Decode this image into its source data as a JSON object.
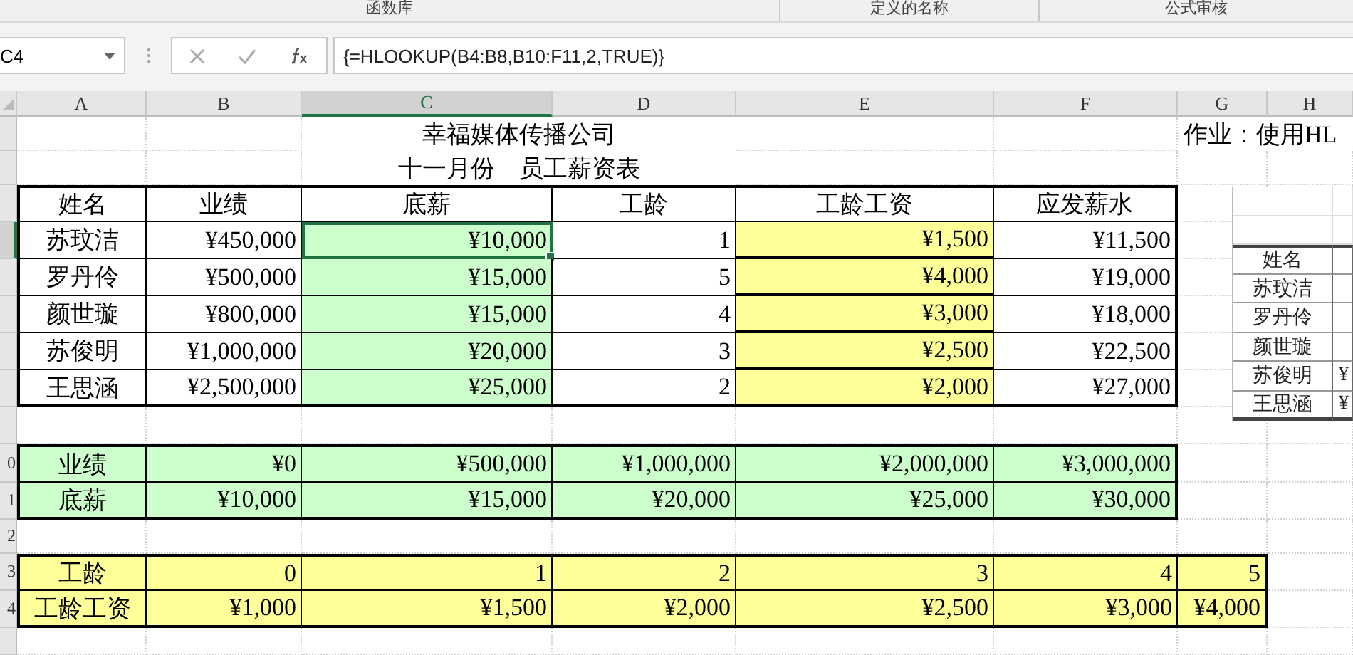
{
  "ribbon_groups": [
    "函数库",
    "定义的名称",
    "公式审核"
  ],
  "formula_bar": {
    "name_box": "C4",
    "formula": "{=HLOOKUP(B4:B8,B10:F11,2,TRUE)}"
  },
  "columns": [
    {
      "label": "A",
      "selected": false
    },
    {
      "label": "B",
      "selected": false
    },
    {
      "label": "C",
      "selected": true
    },
    {
      "label": "D",
      "selected": false
    },
    {
      "label": "E",
      "selected": false
    },
    {
      "label": "F",
      "selected": false
    },
    {
      "label": "G",
      "selected": false
    },
    {
      "label": "H",
      "selected": false
    }
  ],
  "row_headers": [
    {
      "row_label": "0"
    },
    {
      "row_label": "1"
    },
    {
      "row_label": "2"
    },
    {
      "row_label": "3"
    },
    {
      "row_label": "4"
    }
  ],
  "title": "幸福媒体传播公司",
  "subtitle": "十一月份　员工薪资表",
  "note": "作业：使用HL",
  "salary_table": {
    "columns": [
      "姓名",
      "业绩",
      "底薪",
      "工龄",
      "工龄工资",
      "应发薪水"
    ],
    "rows": [
      {
        "cells": [
          {
            "text": "苏玟洁",
            "selected": false
          },
          {
            "text": "¥450,000",
            "selected": false
          },
          {
            "text": "¥10,000",
            "selected": true
          },
          {
            "text": "1",
            "selected": false
          },
          {
            "text": "¥1,500",
            "selected": false
          },
          {
            "text": "¥11,500",
            "selected": false
          }
        ]
      },
      {
        "cells": [
          {
            "text": "罗丹伶",
            "selected": false
          },
          {
            "text": "¥500,000",
            "selected": false
          },
          {
            "text": "¥15,000",
            "selected": false
          },
          {
            "text": "5",
            "selected": false
          },
          {
            "text": "¥4,000",
            "selected": false
          },
          {
            "text": "¥19,000",
            "selected": false
          }
        ]
      },
      {
        "cells": [
          {
            "text": "颜世璇",
            "selected": false
          },
          {
            "text": "¥800,000",
            "selected": false
          },
          {
            "text": "¥15,000",
            "selected": false
          },
          {
            "text": "4",
            "selected": false
          },
          {
            "text": "¥3,000",
            "selected": false
          },
          {
            "text": "¥18,000",
            "selected": false
          }
        ]
      },
      {
        "cells": [
          {
            "text": "苏俊明",
            "selected": false
          },
          {
            "text": "¥1,000,000",
            "selected": false
          },
          {
            "text": "¥20,000",
            "selected": false
          },
          {
            "text": "3",
            "selected": false
          },
          {
            "text": "¥2,500",
            "selected": false
          },
          {
            "text": "¥22,500",
            "selected": false
          }
        ]
      },
      {
        "cells": [
          {
            "text": "王思涵",
            "selected": false
          },
          {
            "text": "¥2,500,000",
            "selected": false
          },
          {
            "text": "¥25,000",
            "selected": false
          },
          {
            "text": "2",
            "selected": false
          },
          {
            "text": "¥2,000",
            "selected": false
          },
          {
            "text": "¥27,000",
            "selected": false
          }
        ]
      }
    ]
  },
  "base_lookup": [
    {
      "label": "业绩",
      "values": [
        "¥0",
        "¥500,000",
        "¥1,000,000",
        "¥2,000,000",
        "¥3,000,000"
      ]
    },
    {
      "label": "底薪",
      "values": [
        "¥10,000",
        "¥15,000",
        "¥20,000",
        "¥25,000",
        "¥30,000"
      ]
    }
  ],
  "seniority_lookup": [
    {
      "label": "工龄",
      "values": [
        "0",
        "1",
        "2",
        "3",
        "4",
        "5"
      ]
    },
    {
      "label": "工龄工资",
      "values": [
        "¥1,000",
        "¥1,500",
        "¥2,000",
        "¥2,500",
        "¥3,000",
        "¥4,000"
      ]
    }
  ],
  "side_table": {
    "header": "姓名",
    "rows": [
      {
        "name": "苏玟洁"
      },
      {
        "name": "罗丹伶"
      },
      {
        "name": "颜世璇"
      },
      {
        "name": "苏俊明",
        "column_2": "¥"
      },
      {
        "name": "王思涵",
        "column_2": "¥"
      }
    ]
  }
}
